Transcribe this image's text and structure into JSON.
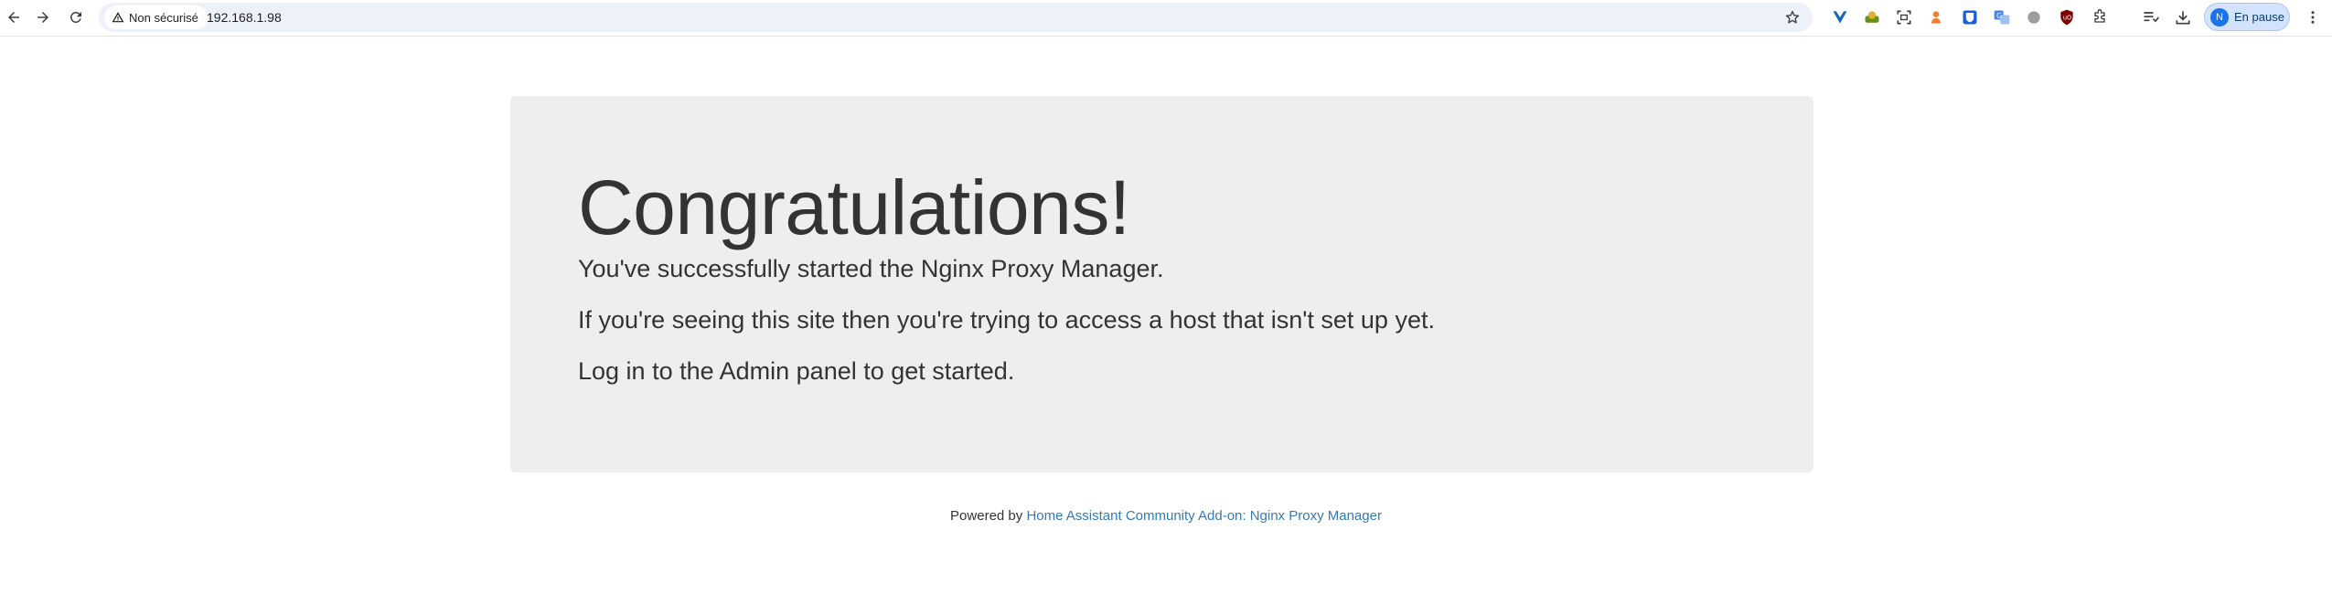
{
  "browser": {
    "security_label": "Non sécurisé",
    "url": "192.168.1.98",
    "profile_initial": "N",
    "profile_label": "En pause",
    "extensions": [
      "vue-devtools-icon",
      "ext-green-icon",
      "screenshot-icon",
      "ext-orange-icon",
      "bitwarden-icon",
      "translate-icon",
      "ext-grey-circle-icon",
      "ublock-icon",
      "extensions-puzzle-icon"
    ]
  },
  "main": {
    "heading": "Congratulations!",
    "line1": "You've successfully started the Nginx Proxy Manager.",
    "line2": "If you're seeing this site then you're trying to access a host that isn't set up yet.",
    "line3": "Log in to the Admin panel to get started."
  },
  "footer": {
    "prefix": "Powered by ",
    "link_text": "Home Assistant Community Add-on: Nginx Proxy Manager"
  },
  "colors": {
    "jumbotron_bg": "#eeeeee",
    "text": "#333333",
    "link": "#337ab7",
    "omnibox_bg": "#edf1f9",
    "profile_bg": "#d3e3fd"
  }
}
